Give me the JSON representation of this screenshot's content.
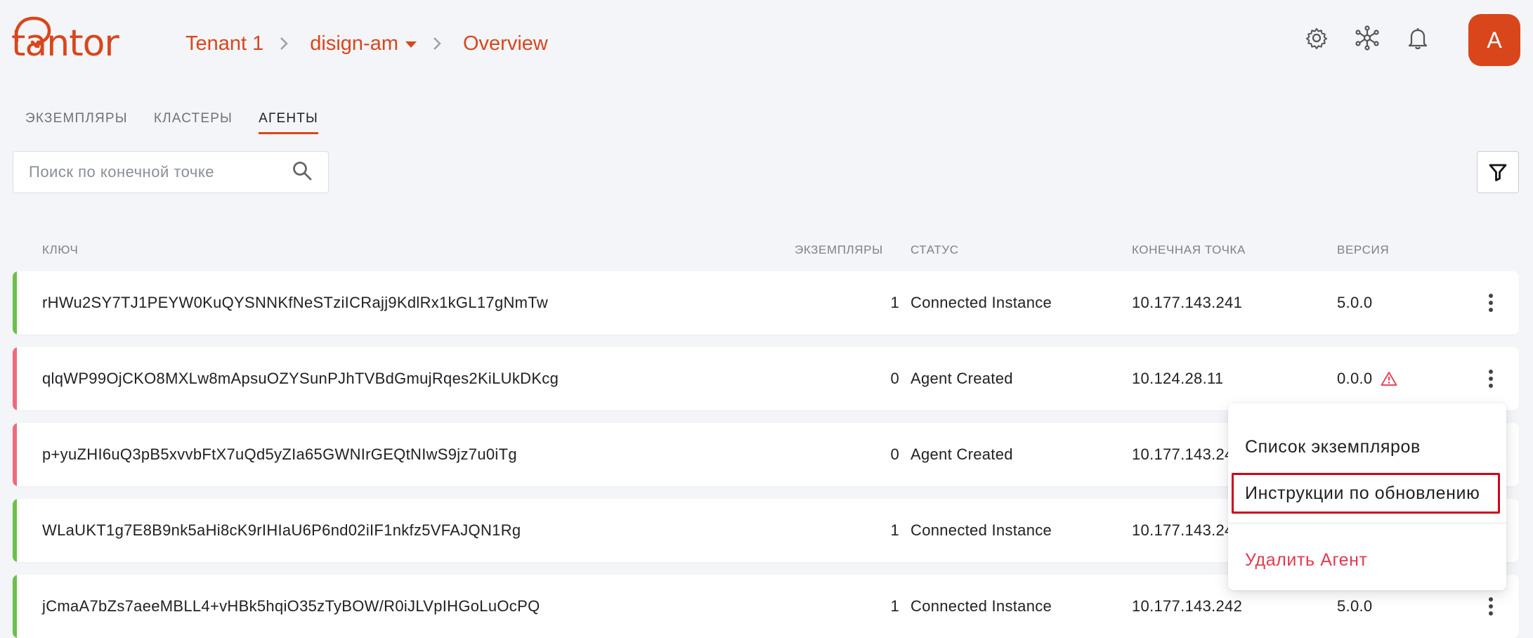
{
  "brand": {
    "logo_text": "tantor",
    "accent": "#d9461c"
  },
  "breadcrumb": {
    "tenant": "Tenant 1",
    "project": "disign-am",
    "page": "Overview"
  },
  "header_icons": [
    "gear-icon",
    "network-icon",
    "bell-icon"
  ],
  "user": {
    "avatar_letter": "A"
  },
  "tabs": [
    {
      "label": "ЭКЗЕМПЛЯРЫ",
      "active": false
    },
    {
      "label": "КЛАСТЕРЫ",
      "active": false
    },
    {
      "label": "АГЕНТЫ",
      "active": true
    }
  ],
  "search": {
    "placeholder": "Поиск по конечной точке",
    "value": ""
  },
  "table": {
    "columns": {
      "key": "КЛЮЧ",
      "instances": "ЭКЗЕМПЛЯРЫ",
      "status": "СТАТУС",
      "endpoint": "КОНЕЧНАЯ ТОЧКА",
      "version": "ВЕРСИЯ"
    },
    "status_colors": {
      "connected": "#6cc04a",
      "created": "#ef6a7d"
    },
    "rows": [
      {
        "key": "rHWu2SY7TJ1PEYW0KuQYSNNKfNeSTziICRajj9KdlRx1kGL17gNmTw",
        "instances": "1",
        "status": "Connected Instance",
        "endpoint": "10.177.143.241",
        "version": "5.0.0",
        "warning": false,
        "state": "connected"
      },
      {
        "key": "qlqWP99OjCKO8MXLw8mApsuOZYSunPJhTVBdGmujRqes2KiLUkDKcg",
        "instances": "0",
        "status": "Agent Created",
        "endpoint": "10.124.28.11",
        "version": "0.0.0",
        "warning": true,
        "state": "created"
      },
      {
        "key": "p+yuZHI6uQ3pB5xvvbFtX7uQd5yZIa65GWNIrGEQtNIwS9jz7u0iTg",
        "instances": "0",
        "status": "Agent Created",
        "endpoint": "10.177.143.244",
        "version": "",
        "warning": false,
        "state": "created"
      },
      {
        "key": "WLaUKT1g7E8B9nk5aHi8cK9rIHIaU6P6nd02iIF1nkfz5VFAJQN1Rg",
        "instances": "1",
        "status": "Connected Instance",
        "endpoint": "10.177.143.243",
        "version": "",
        "warning": false,
        "state": "connected"
      },
      {
        "key": "jCmaA7bZs7aeeMBLL4+vHBk5hqiO35zTyBOW/R0iJLVpIHGoLuOcPQ",
        "instances": "1",
        "status": "Connected Instance",
        "endpoint": "10.177.143.242",
        "version": "5.0.0",
        "warning": false,
        "state": "connected"
      }
    ]
  },
  "context_menu": {
    "items": [
      {
        "label": "Список экземпляров"
      },
      {
        "label": "Инструкции по обновлению"
      },
      {
        "label": "Удалить Агент"
      }
    ],
    "danger_color": "#e03a4e"
  }
}
